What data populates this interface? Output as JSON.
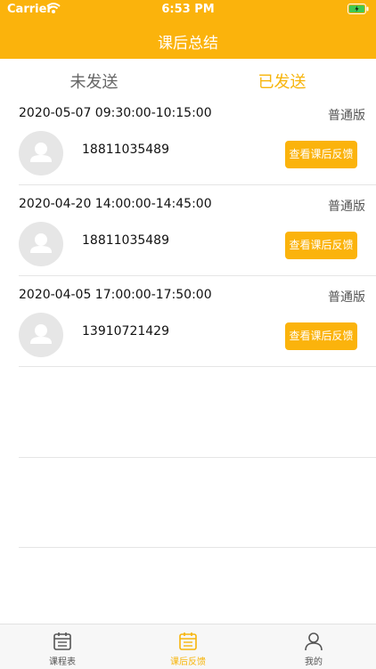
{
  "status_bar": {
    "carrier": "Carrier",
    "time": "6:53 PM"
  },
  "nav": {
    "title": "课后总结"
  },
  "tabs": [
    {
      "label": "未发送"
    },
    {
      "label": "已发送"
    }
  ],
  "records": [
    {
      "datetime": "2020-05-07 09:30:00-10:15:00",
      "version": "普通版",
      "phone": "18811035489",
      "action": "查看课后反馈"
    },
    {
      "datetime": "2020-04-20 14:00:00-14:45:00",
      "version": "普通版",
      "phone": "18811035489",
      "action": "查看课后反馈"
    },
    {
      "datetime": "2020-04-05 17:00:00-17:50:00",
      "version": "普通版",
      "phone": "13910721429",
      "action": "查看课后反馈"
    }
  ],
  "tabbar": [
    {
      "label": "课程表",
      "icon": "calendar-icon"
    },
    {
      "label": "课后反馈",
      "icon": "feedback-list-icon"
    },
    {
      "label": "我的",
      "icon": "person-icon"
    }
  ],
  "colors": {
    "accent": "#fbb30c",
    "active_text": "#f7b50c"
  }
}
